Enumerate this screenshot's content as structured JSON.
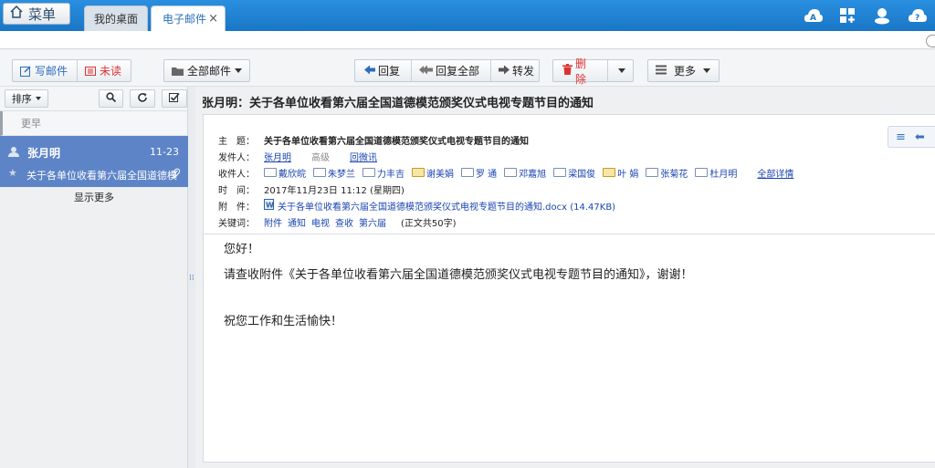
{
  "topbar": {
    "menu_label": "菜单",
    "tabs": [
      {
        "label": "我的桌面"
      },
      {
        "label": "电子邮件",
        "close": "×"
      }
    ],
    "icons": [
      "aa-icon",
      "apps-icon",
      "user-icon",
      "help-icon"
    ]
  },
  "toolbar": {
    "compose": "写邮件",
    "unread": "未读",
    "all_mail": "全部邮件",
    "reply": "回复",
    "reply_all": "回复全部",
    "forward": "转发",
    "delete": "删除",
    "more": "更多"
  },
  "list": {
    "sort_label": "排序",
    "group_header": "更早",
    "items": [
      {
        "sender": "张月明",
        "date": "11-23",
        "subject": "关于各单位收看第六届全国道德模"
      }
    ],
    "show_more": "显示更多"
  },
  "reader": {
    "title": "张月明：关于各单位收看第六届全国道德模范颁奖仪式电视专题节目的通知",
    "labels": {
      "subject": "主　题：",
      "from": "发件人：",
      "to": "收件人：",
      "time": "时　间：",
      "attach": "附　件：",
      "keywords": "关键词："
    },
    "subject": "关于各单位收看第六届全国道德模范颁奖仪式电视专题节目的通知",
    "from": "张月明",
    "priority": "高级",
    "receipt": "回微讯",
    "recipients": [
      "戴欣皖",
      "朱梦兰",
      "力丰吉",
      "谢美娟",
      "罗 通",
      "邓嘉旭",
      "梁国俊",
      "叶 娟",
      "张菊花",
      "杜月明"
    ],
    "recipients_more": "全部详情",
    "time": "2017年11月23日 11:12 (星期四)",
    "attachment": "关于各单位收看第六届全国道德模范颁奖仪式电视专题节目的通知.docx (14.47KB)",
    "keywords": [
      "附件",
      "通知",
      "电视",
      "查收",
      "第六届"
    ],
    "word_count": "(正文共50字)",
    "body": {
      "greeting": "您好！",
      "line1": "请查收附件《关于各单位收看第六届全国道德模范颁奖仪式电视专题节目的通知》，谢谢！",
      "closing": "祝您工作和生活愉快！"
    }
  }
}
